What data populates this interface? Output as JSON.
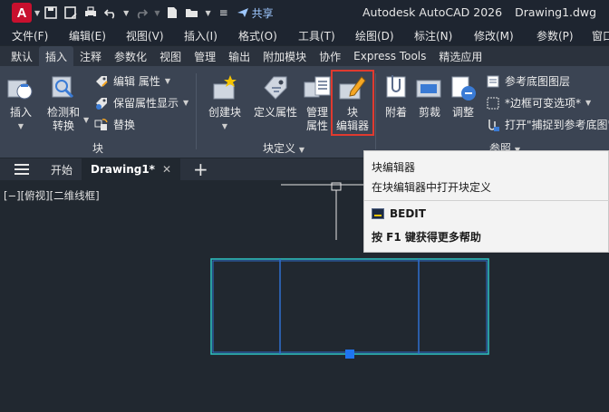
{
  "app": {
    "logo_letter": "A",
    "title": "Autodesk AutoCAD 2026",
    "document": "Drawing1.dwg",
    "share_label": "共享"
  },
  "menu": [
    "文件(F)",
    "编辑(E)",
    "视图(V)",
    "插入(I)",
    "格式(O)",
    "工具(T)",
    "绘图(D)",
    "标注(N)",
    "修改(M)",
    "参数(P)",
    "窗口"
  ],
  "ribbon_tabs": [
    {
      "label": "默认",
      "active": false
    },
    {
      "label": "插入",
      "active": true
    },
    {
      "label": "注释",
      "active": false
    },
    {
      "label": "参数化",
      "active": false
    },
    {
      "label": "视图",
      "active": false
    },
    {
      "label": "管理",
      "active": false
    },
    {
      "label": "输出",
      "active": false
    },
    {
      "label": "附加模块",
      "active": false
    },
    {
      "label": "协作",
      "active": false
    },
    {
      "label": "Express Tools",
      "active": false
    },
    {
      "label": "精选应用",
      "active": false
    }
  ],
  "panels": {
    "block": {
      "title": "块",
      "insert": "插入",
      "detect_l1": "检测和",
      "detect_l2": "转换",
      "edit_attr": "编辑 属性",
      "keep_attr": "保留属性显示",
      "replace": "替换"
    },
    "block_def": {
      "title": "块定义",
      "create": "创建块",
      "define_attr": "定义属性",
      "manage_l1": "管理",
      "manage_l2": "属性",
      "editor_l1": "块",
      "editor_l2": "编辑器"
    },
    "reference": {
      "title": "参照",
      "attach": "附着",
      "clip": "剪裁",
      "adjust": "调整",
      "underlay_layers": "参考底图图层",
      "frame_vary": "*边框可变选项*",
      "snap_underlay": "打开\"捕捉到参考底图\""
    }
  },
  "doc_tabs": [
    {
      "label": "开始",
      "active": false
    },
    {
      "label": "Drawing1*",
      "active": true
    }
  ],
  "viewport_label": "[−][俯视][二维线框]",
  "tooltip": {
    "title": "块编辑器",
    "description": "在块编辑器中打开块定义",
    "command": "BEDIT",
    "help": "按 F1 键获得更多帮助"
  },
  "colors": {
    "background": "#212830",
    "ribbon": "#3b4453",
    "accent_cyan": "#2ec4c4",
    "accent_blue": "#2f6fd0",
    "highlight_red": "#e03a2f"
  }
}
